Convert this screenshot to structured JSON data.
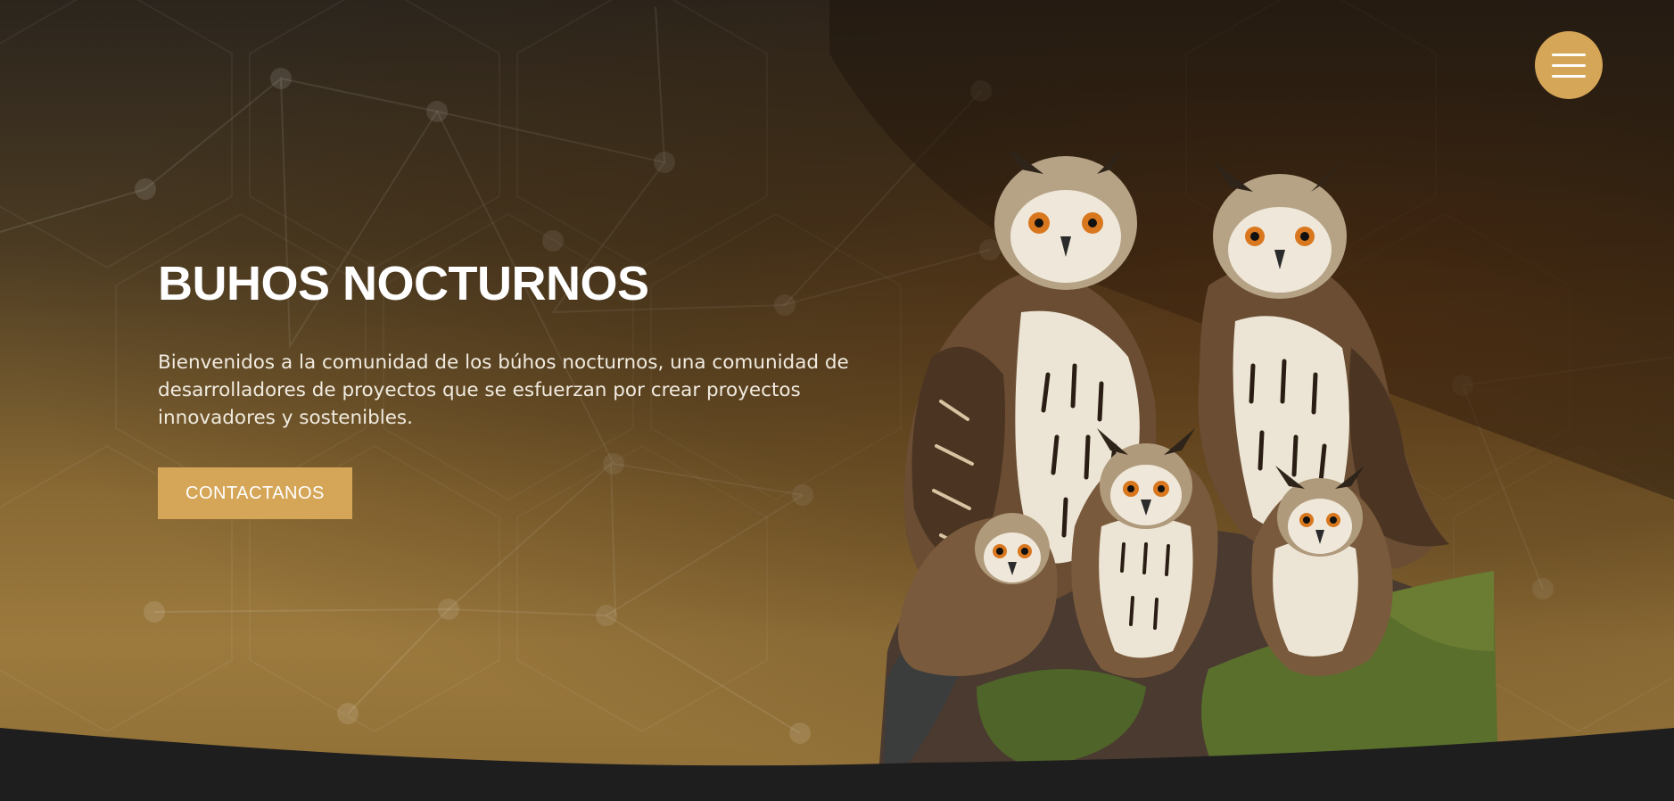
{
  "hero": {
    "title": "BUHOS NOCTURNOS",
    "description": "Bienvenidos a la comunidad de los búhos nocturnos, una comunidad de desarrolladores de proyectos que se esfuerzan por crear proyectos innovadores y sostenibles.",
    "cta_label": "CONTACTANOS",
    "image": "owl-group-image"
  },
  "header": {
    "menu_icon": "hamburger-menu-icon"
  },
  "colors": {
    "accent": "#d6a658",
    "background_bottom": "#1e1e1e",
    "text": "#ffffff"
  }
}
